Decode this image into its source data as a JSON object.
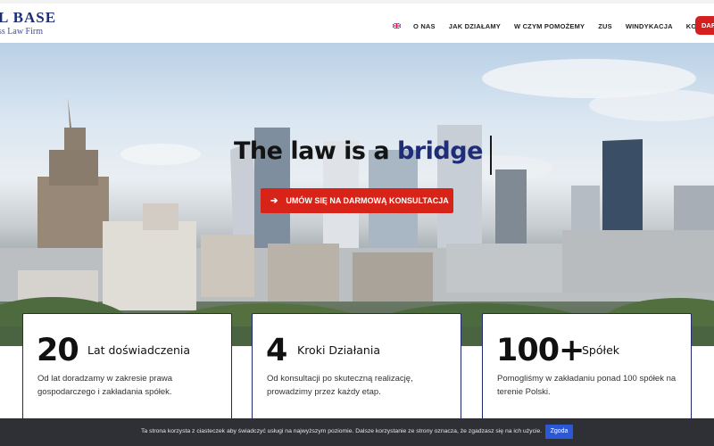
{
  "brand": {
    "logo_main": "L BASE",
    "logo_sub": "ss Law Firm",
    "primary_color": "#1d2e78",
    "accent_color": "#d82418"
  },
  "nav": {
    "flag_icon": "uk-flag-icon",
    "items": [
      "O NAS",
      "JAK DZIAŁAMY",
      "W CZYM POMOŻEMY",
      "ZUS",
      "WINDYKACJA",
      "KONTAKT"
    ],
    "cta_label": "DAR"
  },
  "hero": {
    "title_prefix": "The law is a ",
    "title_accent": "bridge",
    "button_icon": "arrow-right-icon",
    "button_label": "UMÓW SIĘ NA DARMOWĄ KONSULTACJA"
  },
  "stats": [
    {
      "number": "20",
      "label": "Lat doświadczenia",
      "desc": "Od lat doradzamy w zakresie prawa gospodarczego i zakładania spółek."
    },
    {
      "number": "4",
      "label": "Kroki Działania",
      "desc": "Od konsultacji po skuteczną realizację, prowadzimy przez każdy etap."
    },
    {
      "number": "100+",
      "label": "Spółek",
      "desc": "Pomogliśmy w zakładaniu ponad 100 spółek na terenie Polski."
    }
  ],
  "cookie": {
    "text": "Ta strona korzysta z ciasteczek aby świadczyć usługi na najwyższym poziomie. Dalsze korzystanie ze strony oznacza, że zgadzasz się na ich użycie.",
    "accept_label": "Zgoda"
  }
}
